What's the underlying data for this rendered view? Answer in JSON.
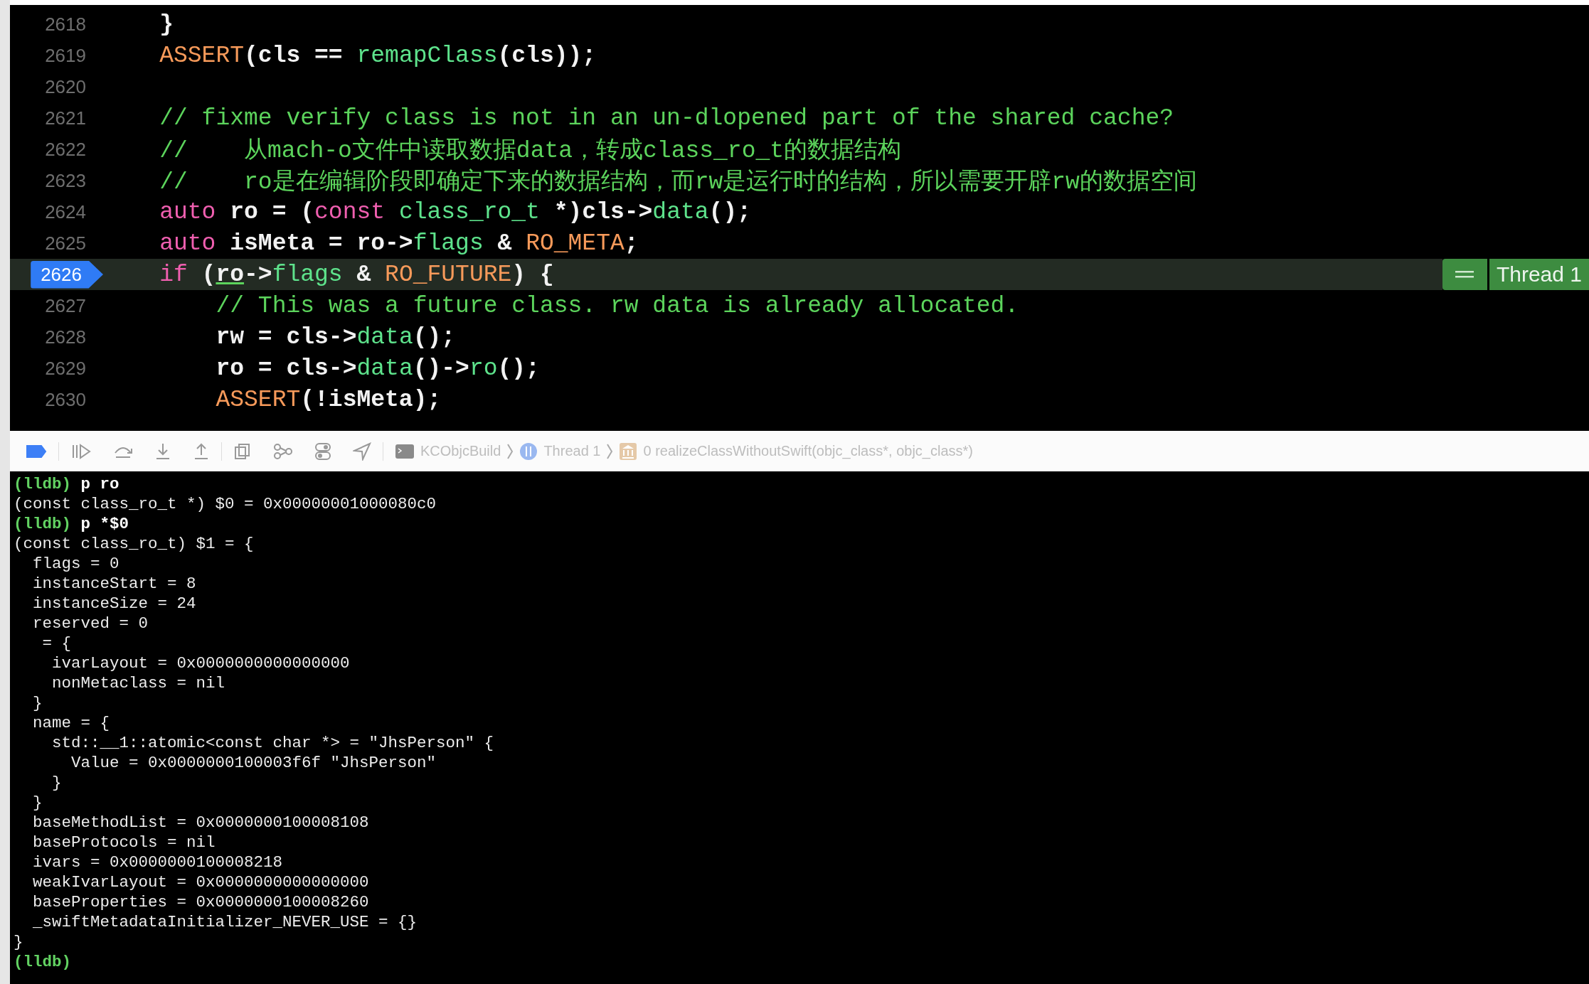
{
  "editor": {
    "lines": [
      {
        "number": "2618",
        "current": false,
        "tokens": [
          {
            "kind": "plain",
            "text": "}"
          }
        ]
      },
      {
        "number": "2619",
        "current": false,
        "tokens": [
          {
            "kind": "macro",
            "text": "ASSERT"
          },
          {
            "kind": "plain",
            "text": "(cls == "
          },
          {
            "kind": "call",
            "text": "remapClass"
          },
          {
            "kind": "plain",
            "text": "(cls));"
          }
        ]
      },
      {
        "number": "2620",
        "current": false
      },
      {
        "number": "2621",
        "current": false,
        "tokens": [
          {
            "kind": "comment",
            "text": "// fixme verify class is not in an un-dlopened part of the shared cache?"
          }
        ]
      },
      {
        "number": "2622",
        "current": false,
        "tokens": [
          {
            "kind": "comment",
            "text": "//    从mach-o文件中读取数据data，转成class_ro_t的数据结构"
          }
        ]
      },
      {
        "number": "2623",
        "current": false,
        "tokens": [
          {
            "kind": "comment",
            "text": "//    ro是在编辑阶段即确定下来的数据结构，而rw是运行时的结构，所以需要开辟rw的数据空间"
          }
        ]
      },
      {
        "number": "2624",
        "current": false,
        "tokens": [
          {
            "kind": "keyword",
            "text": "auto"
          },
          {
            "kind": "plain",
            "text": " ro = ("
          },
          {
            "kind": "keyword",
            "text": "const"
          },
          {
            "kind": "call",
            "text": " class_ro_t"
          },
          {
            "kind": "plain",
            "text": " *)cls->"
          },
          {
            "kind": "call",
            "text": "data"
          },
          {
            "kind": "plain",
            "text": "();"
          }
        ]
      },
      {
        "number": "2625",
        "current": false,
        "tokens": [
          {
            "kind": "keyword",
            "text": "auto"
          },
          {
            "kind": "plain",
            "text": " isMeta = ro->"
          },
          {
            "kind": "call",
            "text": "flags"
          },
          {
            "kind": "plain",
            "text": " & "
          },
          {
            "kind": "macro",
            "text": "RO_META"
          },
          {
            "kind": "plain",
            "text": ";"
          }
        ]
      },
      {
        "number": "2626",
        "current": true,
        "annotation": "Thread 1",
        "tokens": [
          {
            "kind": "keyword",
            "text": "if"
          },
          {
            "kind": "plain",
            "text": " ("
          },
          {
            "kind": "underlined",
            "text": "ro"
          },
          {
            "kind": "plain",
            "text": "->"
          },
          {
            "kind": "call",
            "text": "flags"
          },
          {
            "kind": "plain",
            "text": " & "
          },
          {
            "kind": "macro",
            "text": "RO_FUTURE"
          },
          {
            "kind": "plain",
            "text": ") {"
          }
        ],
        "children": [
          {
            "number": "2627",
            "current": false,
            "tokens": [
              {
                "kind": "comment",
                "text": "// This was a future class. rw data is already allocated."
              }
            ]
          },
          {
            "number": "2628",
            "current": false,
            "tokens": [
              {
                "kind": "plain",
                "text": "rw = cls->"
              },
              {
                "kind": "call",
                "text": "data"
              },
              {
                "kind": "plain",
                "text": "();"
              }
            ]
          },
          {
            "number": "2629",
            "current": false,
            "tokens": [
              {
                "kind": "plain",
                "text": "ro = cls->"
              },
              {
                "kind": "call",
                "text": "data"
              },
              {
                "kind": "plain",
                "text": "()->"
              },
              {
                "kind": "call",
                "text": "ro"
              },
              {
                "kind": "plain",
                "text": "();"
              }
            ]
          },
          {
            "number": "2630",
            "current": false,
            "tokens": [
              {
                "kind": "macro",
                "text": "ASSERT"
              },
              {
                "kind": "plain",
                "text": "(!isMeta);"
              }
            ]
          }
        ]
      }
    ]
  },
  "debug_bar": {
    "breakpoints_on": true,
    "breadcrumbs": [
      {
        "kind": "target",
        "label": "KCObjcBuild"
      },
      {
        "kind": "thread",
        "label": "Thread 1"
      },
      {
        "kind": "frame",
        "label": "0 realizeClassWithoutSwift(objc_class*, objc_class*)"
      }
    ]
  },
  "console": {
    "lines": [
      {
        "kind": "prompt",
        "prompt": "(lldb)",
        "text": "p ro"
      },
      {
        "kind": "output",
        "text": "(const class_ro_t *) $0 = 0x00000001000080c0"
      },
      {
        "kind": "prompt",
        "prompt": "(lldb)",
        "text": "p *$0"
      },
      {
        "kind": "output",
        "text": "(const class_ro_t) $1 = {"
      },
      {
        "kind": "output",
        "text": "  flags = 0"
      },
      {
        "kind": "output",
        "text": "  instanceStart = 8"
      },
      {
        "kind": "output",
        "text": "  instanceSize = 24"
      },
      {
        "kind": "output",
        "text": "  reserved = 0"
      },
      {
        "kind": "output",
        "text": "   = {"
      },
      {
        "kind": "output",
        "text": "    ivarLayout = 0x0000000000000000"
      },
      {
        "kind": "output",
        "text": "    nonMetaclass = nil"
      },
      {
        "kind": "output",
        "text": "  }"
      },
      {
        "kind": "output",
        "text": "  name = {"
      },
      {
        "kind": "output",
        "text": "    std::__1::atomic<const char *> = \"JhsPerson\" {"
      },
      {
        "kind": "output",
        "text": "      Value = 0x0000000100003f6f \"JhsPerson\""
      },
      {
        "kind": "output",
        "text": "    }"
      },
      {
        "kind": "output",
        "text": "  }"
      },
      {
        "kind": "output",
        "text": "  baseMethodList = 0x0000000100008108"
      },
      {
        "kind": "output",
        "text": "  baseProtocols = nil"
      },
      {
        "kind": "output",
        "text": "  ivars = 0x0000000100008218"
      },
      {
        "kind": "output",
        "text": "  weakIvarLayout = 0x0000000000000000"
      },
      {
        "kind": "output",
        "text": "  baseProperties = 0x0000000100008260"
      },
      {
        "kind": "output",
        "text": "  _swiftMetadataInitializer_NEVER_USE = {}"
      },
      {
        "kind": "output",
        "text": "}"
      },
      {
        "kind": "prompt",
        "prompt": "(lldb)"
      }
    ]
  }
}
